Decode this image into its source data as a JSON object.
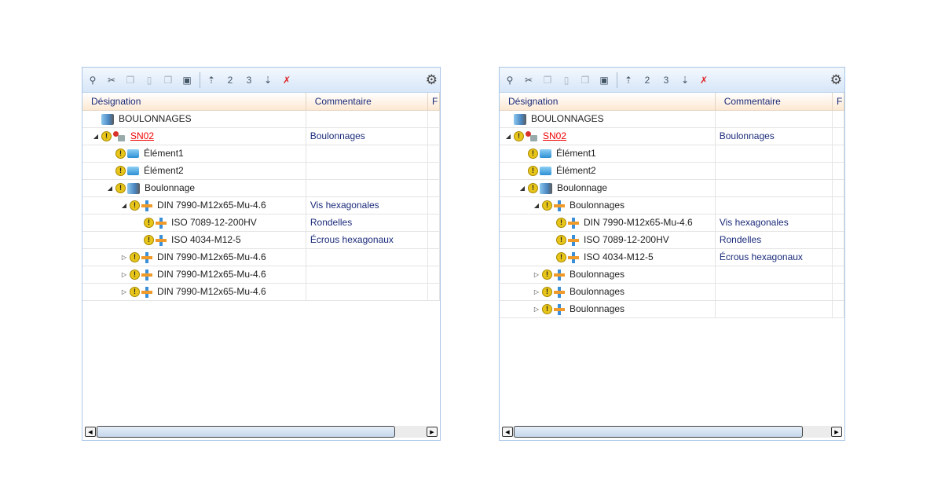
{
  "toolbar": {
    "icons": [
      "find-icon",
      "cut-icon",
      "copy-icon",
      "paste-icon",
      "copy-special-icon",
      "paste-special-icon",
      "expand-level-1-icon",
      "expand-level-2-icon",
      "expand-level-3-icon",
      "expand-all-icon",
      "clear-sort-icon"
    ],
    "settings_icon": "gear-icon"
  },
  "panels": [
    {
      "columns": [
        "Désignation",
        "Commentaire",
        "F"
      ],
      "rows": [
        {
          "level": 0,
          "expander": "",
          "icons": [
            "assembly"
          ],
          "label": "BOULONNAGES",
          "comment": ""
        },
        {
          "level": 0,
          "expander": "expanded",
          "icons": [
            "warn",
            "sn"
          ],
          "label": "SN02",
          "link": true,
          "comment": "Boulonnages"
        },
        {
          "level": 1,
          "expander": "",
          "icons": [
            "warn",
            "block"
          ],
          "label": "Élément1",
          "comment": ""
        },
        {
          "level": 1,
          "expander": "",
          "icons": [
            "warn",
            "block"
          ],
          "label": "Élément2",
          "comment": ""
        },
        {
          "level": 1,
          "expander": "expanded",
          "icons": [
            "warn",
            "assembly"
          ],
          "label": "Boulonnage",
          "comment": ""
        },
        {
          "level": 2,
          "expander": "expanded",
          "icons": [
            "warn",
            "bolt"
          ],
          "label": "DIN 7990-M12x65-Mu-4.6",
          "comment": "Vis hexagonales"
        },
        {
          "level": 3,
          "expander": "",
          "icons": [
            "warn",
            "bolt"
          ],
          "label": "ISO 7089-12-200HV",
          "comment": "Rondelles"
        },
        {
          "level": 3,
          "expander": "",
          "icons": [
            "warn",
            "bolt"
          ],
          "label": "ISO 4034-M12-5",
          "comment": "Écrous hexagonaux"
        },
        {
          "level": 2,
          "expander": "collapsed",
          "icons": [
            "warn",
            "bolt"
          ],
          "label": "DIN 7990-M12x65-Mu-4.6",
          "comment": ""
        },
        {
          "level": 2,
          "expander": "collapsed",
          "icons": [
            "warn",
            "bolt"
          ],
          "label": "DIN 7990-M12x65-Mu-4.6",
          "comment": ""
        },
        {
          "level": 2,
          "expander": "collapsed",
          "icons": [
            "warn",
            "bolt"
          ],
          "label": "DIN 7990-M12x65-Mu-4.6",
          "comment": ""
        }
      ]
    },
    {
      "columns": [
        "Désignation",
        "Commentaire",
        "F"
      ],
      "rows": [
        {
          "level": 0,
          "expander": "",
          "icons": [
            "assembly"
          ],
          "label": "BOULONNAGES",
          "comment": ""
        },
        {
          "level": 0,
          "expander": "expanded",
          "icons": [
            "warn",
            "sn"
          ],
          "label": "SN02",
          "link": true,
          "comment": "Boulonnages"
        },
        {
          "level": 1,
          "expander": "",
          "icons": [
            "warn",
            "block"
          ],
          "label": "Élément1",
          "comment": ""
        },
        {
          "level": 1,
          "expander": "",
          "icons": [
            "warn",
            "block"
          ],
          "label": "Élément2",
          "comment": ""
        },
        {
          "level": 1,
          "expander": "expanded",
          "icons": [
            "warn",
            "assembly"
          ],
          "label": "Boulonnage",
          "comment": ""
        },
        {
          "level": 2,
          "expander": "expanded",
          "icons": [
            "warn",
            "bolt"
          ],
          "label": "Boulonnages",
          "comment": ""
        },
        {
          "level": 3,
          "expander": "",
          "icons": [
            "warn",
            "bolt"
          ],
          "label": "DIN 7990-M12x65-Mu-4.6",
          "comment": "Vis hexagonales"
        },
        {
          "level": 3,
          "expander": "",
          "icons": [
            "warn",
            "bolt"
          ],
          "label": "ISO 7089-12-200HV",
          "comment": "Rondelles"
        },
        {
          "level": 3,
          "expander": "",
          "icons": [
            "warn",
            "bolt"
          ],
          "label": "ISO 4034-M12-5",
          "comment": "Écrous hexagonaux"
        },
        {
          "level": 2,
          "expander": "collapsed",
          "icons": [
            "warn",
            "bolt"
          ],
          "label": "Boulonnages",
          "comment": ""
        },
        {
          "level": 2,
          "expander": "collapsed",
          "icons": [
            "warn",
            "bolt"
          ],
          "label": "Boulonnages",
          "comment": ""
        },
        {
          "level": 2,
          "expander": "collapsed",
          "icons": [
            "warn",
            "bolt"
          ],
          "label": "Boulonnages",
          "comment": ""
        }
      ]
    }
  ]
}
